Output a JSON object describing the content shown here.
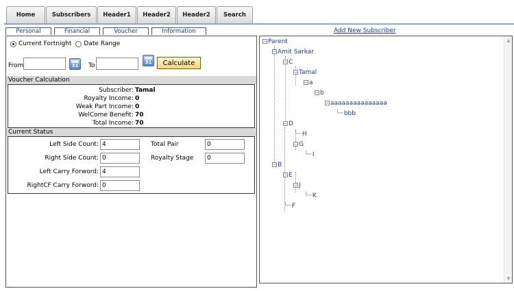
{
  "top_tabs": [
    "Home",
    "Subscribers",
    "Header1",
    "Header2",
    "Header2",
    "Search"
  ],
  "sub_tabs": [
    "Personal",
    "Financial",
    "Voucher",
    "Information"
  ],
  "add_link": "Add New Subscriber",
  "period": {
    "option1": "Current Fortnight",
    "option2": "Date Range",
    "selected": "Current Fortnight"
  },
  "from_label": "From",
  "to_label": "To",
  "from_value": "",
  "to_value": "",
  "calendar_icon_text": "31",
  "calculate_label": "Calculate",
  "voucher": {
    "heading": "Voucher Calculation",
    "rows": [
      {
        "label": "Subscriber:",
        "value": "Tamal"
      },
      {
        "label": "Royalty Income:",
        "value": "0"
      },
      {
        "label": "Weak Part Income:",
        "value": "0"
      },
      {
        "label": "WelCome Benefit:",
        "value": "70"
      },
      {
        "label": "Total Income:",
        "value": "70"
      }
    ]
  },
  "status": {
    "heading": "Current Status",
    "left_side_count_label": "Left Side Count:",
    "left_side_count": "4",
    "right_side_count_label": "Right Side Count:",
    "right_side_count": "0",
    "left_carry_label": "Left Carry Forword:",
    "left_carry": "4",
    "rightcf_label": "RightCF Carry Forword:",
    "rightcf": "0",
    "total_pair_label": "Total Pair",
    "total_pair": "0",
    "royalty_stage_label": "Royalty Stage",
    "royalty_stage": "0"
  },
  "tree": {
    "parent": "Parent",
    "amit": "Amit Sarkar",
    "c": "C",
    "tamal": "Tamal",
    "a": "a",
    "b_lower": "b",
    "aaa": "aaaaaaaaaaaaaaa",
    "bbb": "bbb",
    "d": "D",
    "h": "H",
    "g": "G",
    "i": "I",
    "b_upper": "B",
    "e": "E",
    "j": "J",
    "k": "K",
    "f": "F"
  }
}
